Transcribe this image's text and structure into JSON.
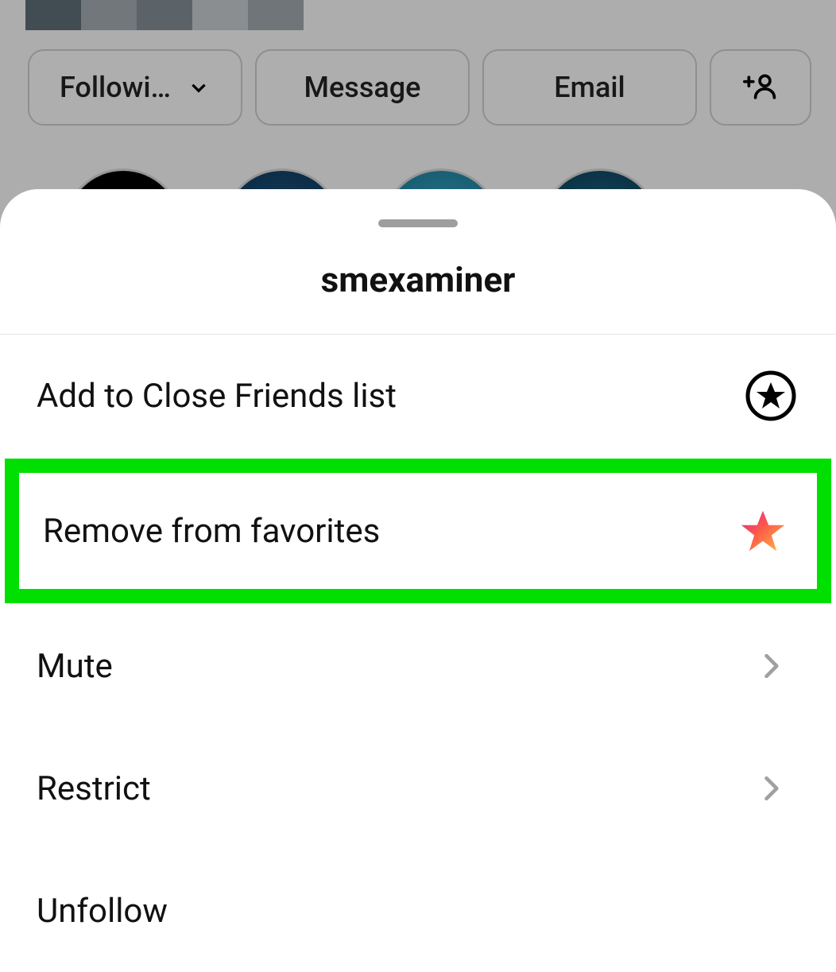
{
  "profile": {
    "buttons": {
      "following": "Followi…",
      "message": "Message",
      "email": "Email"
    }
  },
  "sheet": {
    "title": "smexaminer",
    "items": {
      "close_friends": "Add to Close Friends list",
      "remove_favorites": "Remove from favorites",
      "mute": "Mute",
      "restrict": "Restrict",
      "unfollow": "Unfollow"
    }
  }
}
